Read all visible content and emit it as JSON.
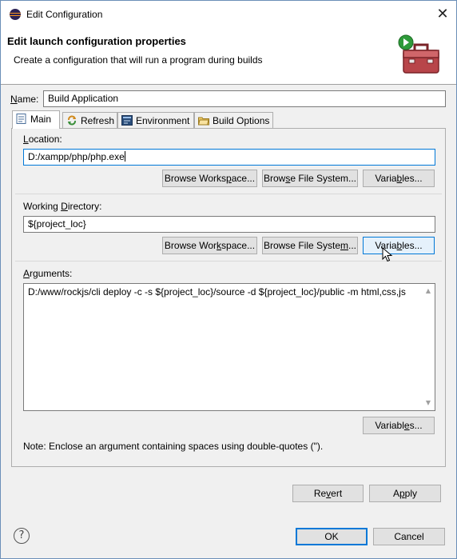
{
  "window": {
    "title": "Edit Configuration",
    "close_glyph": "✕"
  },
  "header": {
    "title": "Edit launch configuration properties",
    "description": "Create a configuration that will run a program during builds",
    "icon": "toolbox-run-icon"
  },
  "name": {
    "label_prefix": "N",
    "label_rest": "ame:",
    "value": "Build Application"
  },
  "tabs": [
    {
      "label": "Main",
      "icon": "main-tab-icon",
      "active": true
    },
    {
      "label": "Refresh",
      "icon": "refresh-icon",
      "active": false
    },
    {
      "label": "Environment",
      "icon": "environment-icon",
      "active": false
    },
    {
      "label": "Build Options",
      "icon": "build-options-icon",
      "active": false
    }
  ],
  "location": {
    "label_prefix": "L",
    "label_rest": "ocation:",
    "value": "D:/xampp/php/php.exe",
    "browse_workspace": {
      "pre": "Browse Works",
      "mn": "p",
      "post": "ace..."
    },
    "browse_file_system": {
      "pre": "Brow",
      "mn": "s",
      "post": "e File System..."
    },
    "variables": {
      "pre": "Varia",
      "mn": "b",
      "post": "les..."
    }
  },
  "working_directory": {
    "label_pre": "Working ",
    "label_mn": "D",
    "label_post": "irectory:",
    "value": "${project_loc}",
    "browse_workspace": {
      "pre": "Browse Wor",
      "mn": "k",
      "post": "space..."
    },
    "browse_file_system": {
      "pre": "Browse File Syste",
      "mn": "m",
      "post": "..."
    },
    "variables": {
      "pre": "Varia",
      "mn": "b",
      "post": "les..."
    }
  },
  "arguments": {
    "label_mn": "A",
    "label_rest": "rguments:",
    "value": "D:/www/rockjs/cli deploy -c -s ${project_loc}/source -d ${project_loc}/public -m html,css,js",
    "variables": {
      "pre": "Variabl",
      "mn": "e",
      "post": "s..."
    },
    "note": "Note: Enclose an argument containing spaces using double-quotes (\")."
  },
  "footer": {
    "revert": {
      "pre": "Re",
      "mn": "v",
      "post": "ert"
    },
    "apply": {
      "pre": "A",
      "mn": "p",
      "post": "ply"
    },
    "ok": "OK",
    "cancel": "Cancel",
    "help_glyph": "?"
  },
  "colors": {
    "accent": "#0078d7",
    "window_border": "#6b8fb8",
    "dialog_bg": "#f0f0f0"
  }
}
